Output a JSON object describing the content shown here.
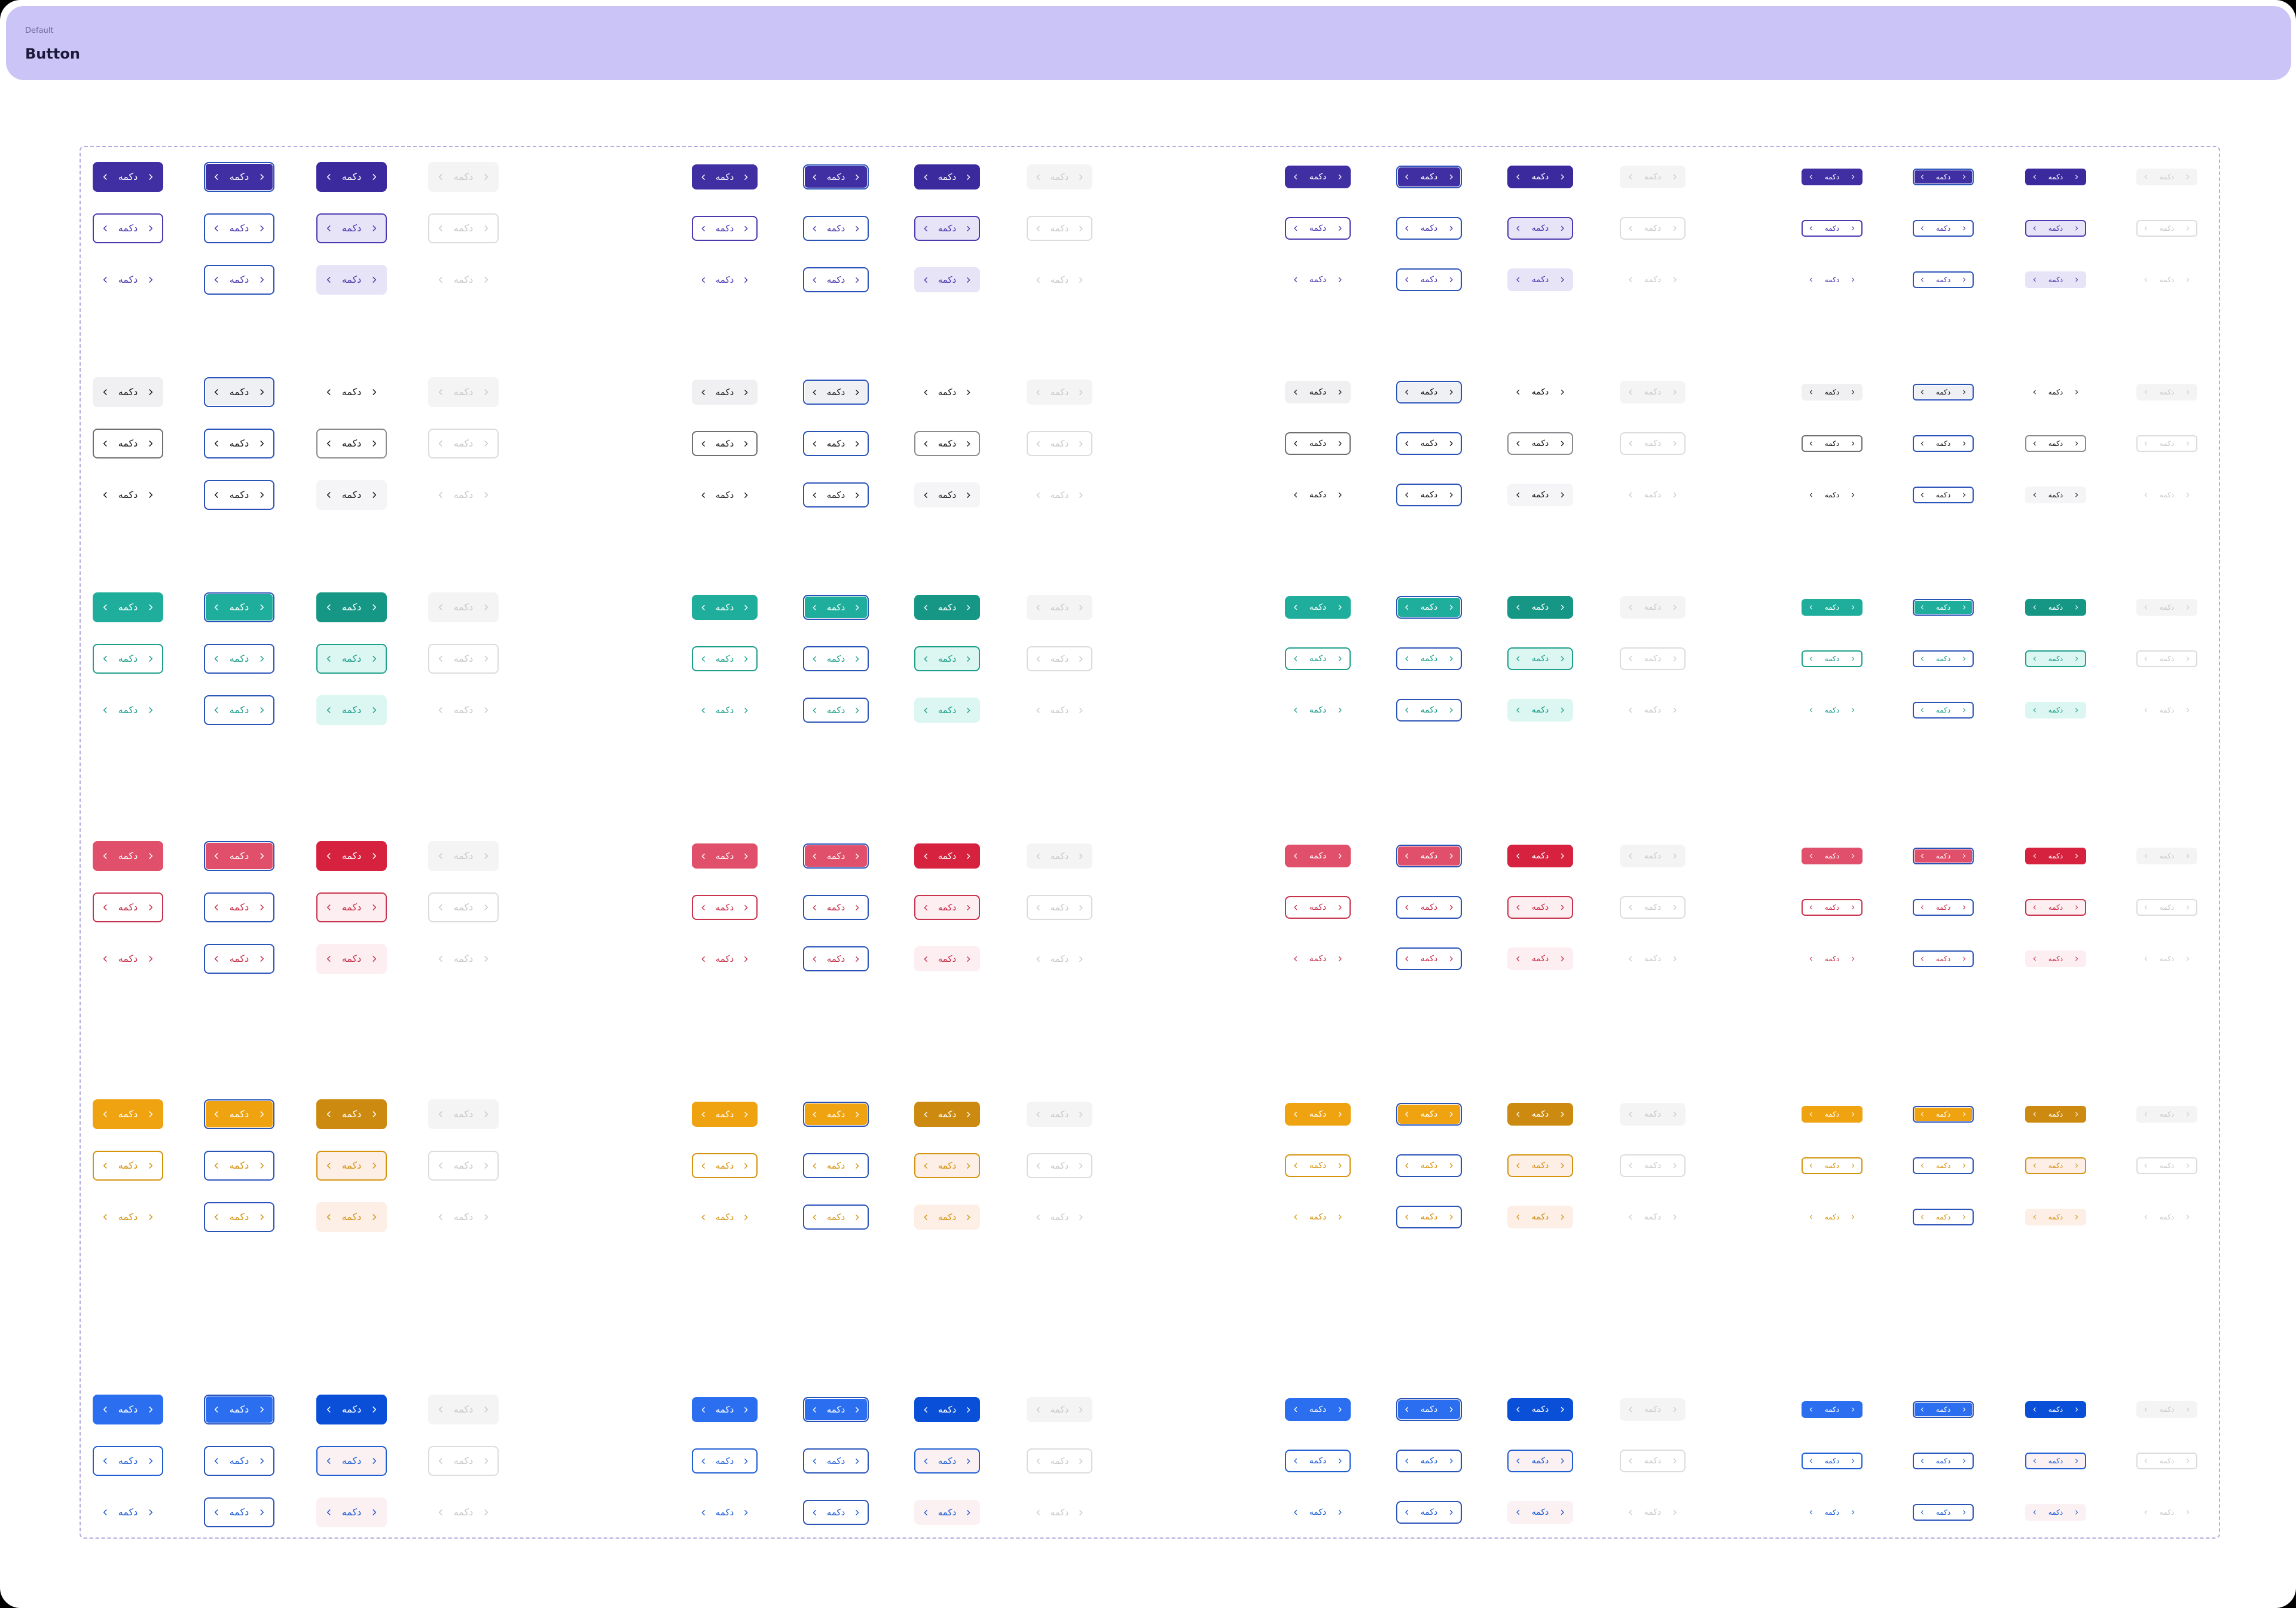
{
  "header": {
    "overline": "Default",
    "title": "Button"
  },
  "button_label": "دکمه",
  "icons": {
    "left": "chevron-left-icon",
    "right": "chevron-right-icon"
  },
  "colors": {
    "primary": {
      "base": "#3f2fa3",
      "dark": "#3a2a9e",
      "tint": "#e8e4f8",
      "text": "#4a3ab0"
    },
    "neutral": {
      "base": "#f0f0f2",
      "dark": "#ffffff",
      "tint": "#f5f5f7",
      "text": "#1a1a1a"
    },
    "success": {
      "base": "#1eae9b",
      "dark": "#169786",
      "tint": "#dcf7f2",
      "text": "#1e9f8c"
    },
    "danger": {
      "base": "#e0506a",
      "dark": "#d6223f",
      "tint": "#fdeef1",
      "text": "#c8324c"
    },
    "warning": {
      "base": "#f0a310",
      "dark": "#cc8b10",
      "tint": "#fdeee6",
      "text": "#d69310"
    },
    "info": {
      "base": "#2b6ff0",
      "dark": "#0a4fd8",
      "tint": "#fbf0f2",
      "text": "#1e5ed4"
    },
    "focus_ring": "#2a53b8",
    "disabled_bg": "#f4f4f5",
    "disabled_border": "#dcdcde",
    "disabled_text": "#c9c9cc"
  }
}
